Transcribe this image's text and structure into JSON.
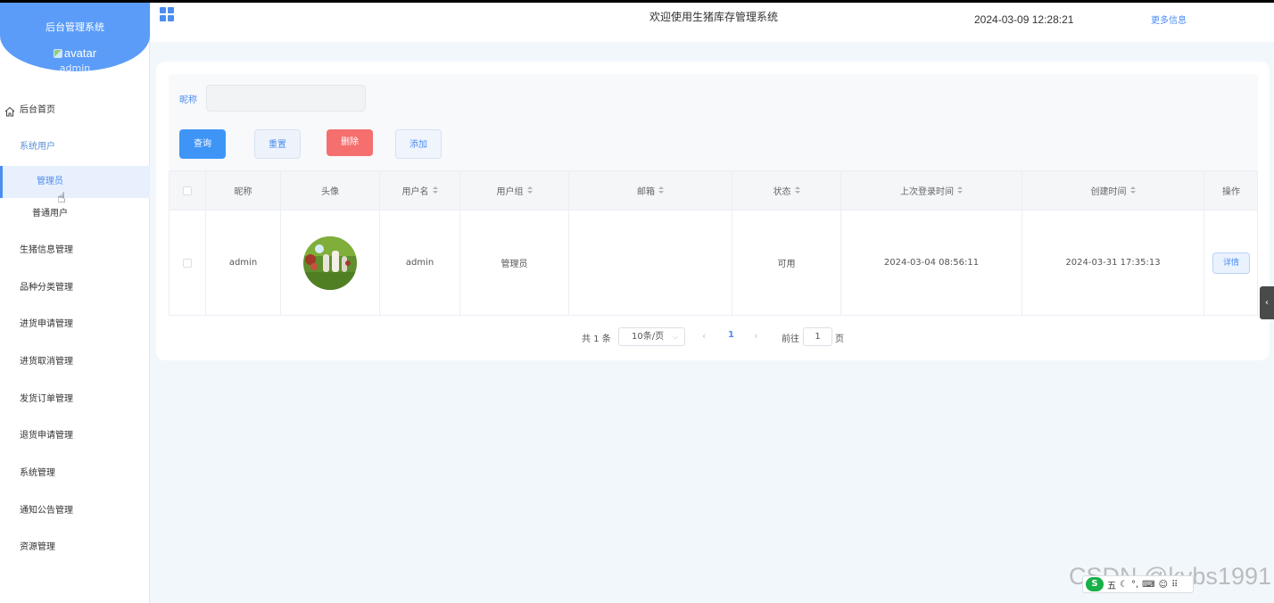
{
  "sidebar": {
    "system_title": "后台管理系统",
    "avatar_alt": "avatar",
    "user_name": "admin",
    "menu": [
      {
        "label": "后台首页"
      },
      {
        "label": "系统用户"
      },
      {
        "label": "管理员"
      },
      {
        "label": "普通用户"
      },
      {
        "label": "生猪信息管理"
      },
      {
        "label": "品种分类管理"
      },
      {
        "label": "进货申请管理"
      },
      {
        "label": "进货取消管理"
      },
      {
        "label": "发货订单管理"
      },
      {
        "label": "退货申请管理"
      },
      {
        "label": "系统管理"
      },
      {
        "label": "通知公告管理"
      },
      {
        "label": "资源管理"
      }
    ]
  },
  "header": {
    "welcome": "欢迎使用生猪库存管理系统",
    "datetime": "2024-03-09 12:28:21",
    "more_info": "更多信息"
  },
  "search": {
    "nickname_label": "昵称",
    "nickname_value": "",
    "buttons": {
      "query": "查询",
      "reset": "重置",
      "delete": "删除",
      "add": "添加"
    }
  },
  "table": {
    "columns": [
      "",
      "昵称",
      "头像",
      "用户名",
      "用户组",
      "邮箱",
      "状态",
      "上次登录时间",
      "创建时间",
      "操作"
    ],
    "rows": [
      {
        "nickname": "admin",
        "username": "admin",
        "group": "管理员",
        "email": "",
        "status": "可用",
        "last_login": "2024-03-04 08:56:11",
        "created": "2024-03-31 17:35:13",
        "action": "详情"
      }
    ]
  },
  "pagination": {
    "total": "共 1 条",
    "page_size": "10条/页",
    "current_page": "1",
    "goto_label": "前往",
    "goto_value": "1",
    "page_suffix": "页"
  },
  "watermark": "CSDN @kybs1991",
  "ime": {
    "logo": "S",
    "mode": "五"
  },
  "colors": {
    "primary": "#4b8df0",
    "sidebar_head": "#5b9cf8",
    "danger": "#f56f6f",
    "background": "#f2f7fc"
  }
}
